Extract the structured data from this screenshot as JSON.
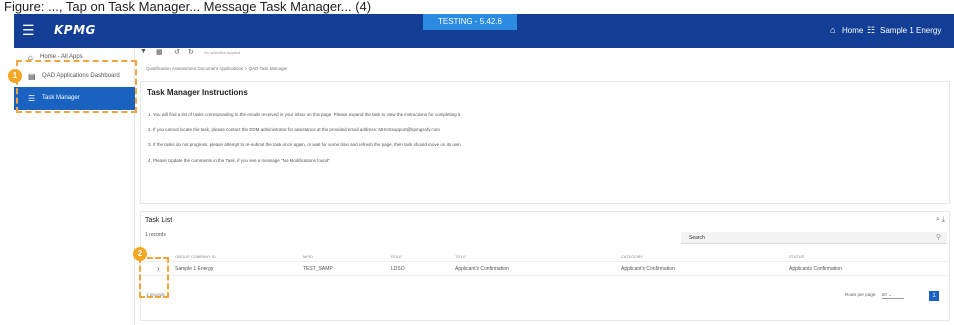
{
  "caption": "Figure: ..., Tap on Task Manager... Message Task Manager... (4)",
  "topbar": {
    "menu_icon": "hamburger-menu-icon",
    "logo": "KPMG",
    "environment": "TESTING - 5.42.6",
    "home_label": "Home",
    "org_label": "Sample 1 Energy"
  },
  "sidebar": {
    "items": [
      {
        "label": "Home - All Apps",
        "icon": "home-icon"
      },
      {
        "label": "QAD Applications Dashboard",
        "icon": "dashboard-icon"
      },
      {
        "label": "Task Manager",
        "icon": "list-icon"
      }
    ]
  },
  "badges": {
    "one": "1",
    "two": "2"
  },
  "toolbar": {
    "status_text": "No selection applied"
  },
  "breadcrumb": {
    "parent": "Qualification Assessment Document Applications",
    "separator": ">",
    "current": "QAD Task Manager"
  },
  "instructions": {
    "title": "Task Manager Instructions",
    "lines": [
      "1. You will find a list of tasks corresponding to the emails received in your inbox on this page. Please expand the task to view the instructions for completing it.",
      "2. If you cannot locate the task, please contact the EDM administrator for assistance at the provided email address: MHHSsupport@kpmgsofy.com",
      "3. If the tasks do not progress, please attempt to re-submit the task once again, or wait for some time and refresh the page, then task should move on its own",
      "4. Please Update the comments in the Task, if you see a message \"No Modifications found\""
    ]
  },
  "task_list": {
    "title": "Task List",
    "records": "1 records",
    "search_label": "Search",
    "columns": [
      "GROUP COMPANY ID",
      "MPID",
      "ROLE",
      "TITLE",
      "CATEGORY",
      "STATUS"
    ],
    "rows": [
      {
        "group_company": "Sample 1 Energy",
        "mpid": "TEST_SAMP",
        "role": "LDSO",
        "title": "Applicant's Confirmation",
        "category": "Applicant's Confirmation",
        "status": "Applicants Confirmation"
      }
    ],
    "footer": "1 records",
    "rows_per_page_label": "Rows per page:",
    "rows_per_page_value": "20",
    "current_page": "1"
  },
  "colors": {
    "topbar": "#123e95",
    "accent": "#1a62bf",
    "callout": "#f0a53e"
  }
}
